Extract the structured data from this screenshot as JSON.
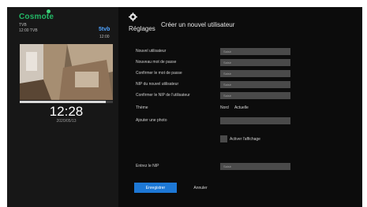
{
  "sidebar": {
    "brand": "Cosmote",
    "channel_badge": "5tvb",
    "program_line1": "TVB",
    "program_line2": "12:00 TVB",
    "program_time": "12:00",
    "progress_fraction": 0.92,
    "clock": "12:28",
    "date": "2020/05/13"
  },
  "header": {
    "settings_label": "Réglages",
    "page_title": "Créer un nouvel utilisateur"
  },
  "form": {
    "rows": [
      {
        "label": "Nouvel utilisateur",
        "placeholder": "Saisir"
      },
      {
        "label": "Nouveau mot de passe",
        "placeholder": "Saisir"
      },
      {
        "label": "Confirmer le mot de passe",
        "placeholder": "Saisir"
      },
      {
        "label": "NIP du nouvel utilisateur",
        "placeholder": "Saisir"
      },
      {
        "label": "Confirmer le NIP de l'utilisateur",
        "placeholder": "Saisir"
      }
    ],
    "theme_label": "Thème",
    "theme_options": [
      "Nord",
      "Actuelle"
    ],
    "avatar_label": "Ajouter une photo",
    "avatar_placeholder": "",
    "checkbox_label": "Activer l'affichage",
    "pin_label": "Entrez le NIP",
    "pin_placeholder": "Saisir",
    "submit_label": "Enregistrer",
    "cancel_label": "Annuler"
  }
}
